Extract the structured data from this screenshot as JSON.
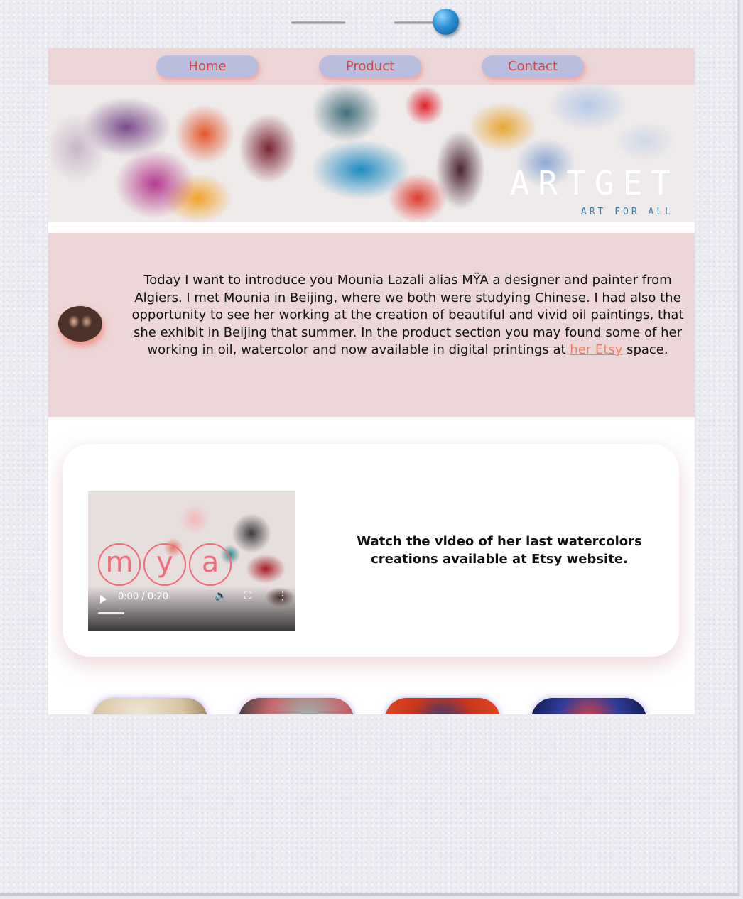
{
  "nav": {
    "items": [
      {
        "label": "Home"
      },
      {
        "label": "Product"
      },
      {
        "label": "Contact"
      }
    ]
  },
  "banner": {
    "title": "ARTGET",
    "subtitle": "ART FOR ALL"
  },
  "intro": {
    "text_before": "Today I want to introduce you Mounia Lazali alias MŸA a designer and painter from Algiers. I met Mounia in Beijing, where we both were studying Chinese. I had also the opportunity to see her working at the creation of beautiful and vivid oil paintings, that she exhibit in Beijing that summer. In the product section you may found some of her working in oil, watercolor and now available in digital printings at ",
    "link_text": "her Etsy",
    "text_after": " space."
  },
  "video": {
    "logo_letters": [
      "m",
      "y",
      "a"
    ],
    "time": "0:00 / 0:20",
    "progress": 0.14,
    "caption": "Watch the video of her last watercolors creations available at Etsy website."
  },
  "colors": {
    "nav_bg": "#ecd6d8",
    "nav_button": "#b9bedf",
    "nav_text": "#d8473f",
    "link": "#f07f60",
    "pin": "#2d8fd2"
  },
  "icons": {
    "play": "play-icon",
    "volume": "volume-icon",
    "fullscreen": "fullscreen-icon",
    "more": "more-icon",
    "pin": "push-pin-icon"
  }
}
